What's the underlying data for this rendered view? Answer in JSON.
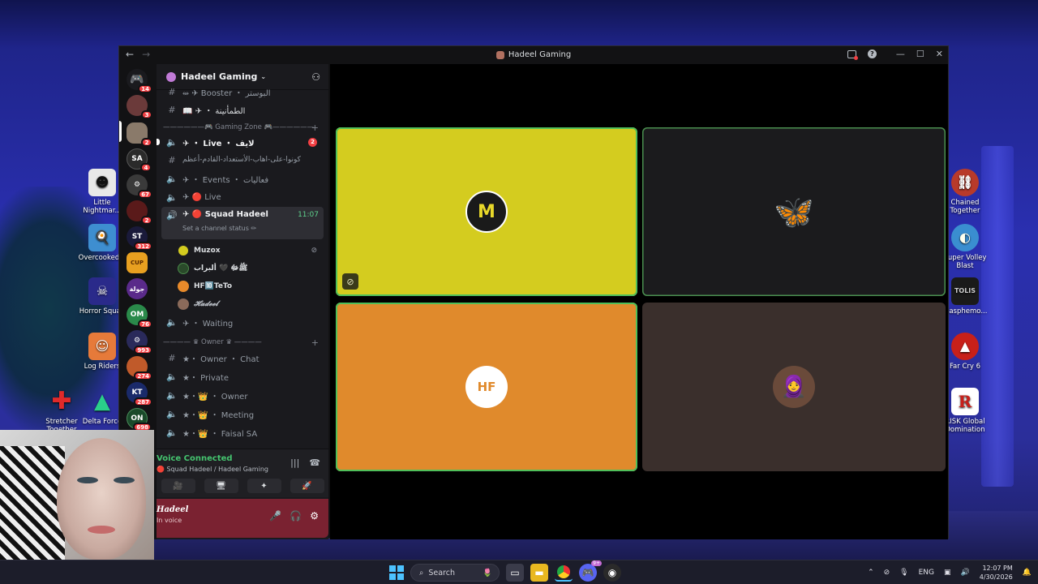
{
  "desktop": {
    "left_icons": [
      {
        "label": "Little Nightmar...",
        "color": "#e8e8e8"
      },
      {
        "label": "Overcooked 2",
        "color": "#3e8ed0"
      },
      {
        "label": "Horror Squad",
        "color": "#2a2a8a"
      },
      {
        "label": "Log Riders",
        "color": "#e67a3a"
      },
      {
        "label": "Stretcher Together",
        "color": "#d02a2a"
      },
      {
        "label": "Delta Force",
        "color": "#2acf8a"
      }
    ],
    "right_icons": [
      {
        "label": "Chained Together",
        "color": "#b83a2a"
      },
      {
        "label": "Super Volley Blast",
        "color": "#3a8ed0"
      },
      {
        "label": "blasphemo...",
        "color": "#1a1a1a"
      },
      {
        "label": "Far Cry 6",
        "color": "#c8201a"
      },
      {
        "label": "RISK Global Domination",
        "color": "#fff"
      }
    ]
  },
  "window": {
    "title": "Hadeel Gaming",
    "back": "←",
    "forward": "→",
    "help": "?",
    "minimize": "—",
    "maximize": "☐",
    "close": "✕"
  },
  "guilds": [
    {
      "glyph": "🎮",
      "badge": "14",
      "bg": "#5865f2"
    },
    {
      "glyph": "",
      "badge": "3",
      "bg": "#6b3a3a"
    },
    {
      "glyph": "",
      "badge": "2",
      "bg": "#8a7a6a"
    },
    {
      "glyph": "SA",
      "badge": "4",
      "bg": "#2a2a2a"
    },
    {
      "glyph": "⚙",
      "badge": "67",
      "bg": "#3a3a3a"
    },
    {
      "glyph": "",
      "badge": "2",
      "bg": "#5a1a1a"
    },
    {
      "glyph": "ST",
      "badge": "312",
      "bg": "#1a1a3a"
    },
    {
      "glyph": "CUP",
      "badge": "",
      "bg": "#e8a020"
    },
    {
      "glyph": "جولة",
      "badge": "",
      "bg": "#5a2a8a"
    },
    {
      "glyph": "OM",
      "badge": "76",
      "bg": "#2a8a4a"
    },
    {
      "glyph": "⚙",
      "badge": "993",
      "bg": "#2a2a5a"
    },
    {
      "glyph": "",
      "badge": "274",
      "bg": "#c05a2a"
    },
    {
      "glyph": "KT",
      "badge": "287",
      "bg": "#1a2a6a"
    },
    {
      "glyph": "ON",
      "badge": "698",
      "bg": "#1a4a2a"
    }
  ],
  "server": {
    "name": "Hadeel Gaming",
    "chevron": "⌄",
    "invite_icon": "person-add-icon"
  },
  "channels": {
    "top": [
      {
        "icon": "#",
        "name": "⥈ ✈ Booster ・ البوستر"
      },
      {
        "icon": "#",
        "name": "📖 ✈ ・ الطمأنينة"
      }
    ],
    "cat_gaming": "——————🎮 Gaming Zone 🎮——————",
    "gaming": [
      {
        "icon": "🔊",
        "name": "✈ ・ Live ・ لايف",
        "badge": "2"
      },
      {
        "icon": "#",
        "name": "كونوا-على-اهاب-الأستعداد-القادم-أعظم"
      },
      {
        "icon": "🔊",
        "name": "✈ ・ Events ・ فعاليات"
      },
      {
        "icon": "🔊",
        "name": "✈ 🔴 Live"
      },
      {
        "icon": "🔊",
        "name": "✈ 🔴 Squad Hadeel",
        "time": "11:07",
        "status": "Set a channel status ✏"
      }
    ],
    "voice_users": [
      {
        "name": "Muzox",
        "color": "#d4cc1f"
      },
      {
        "name": "ﷺﷻ 🖤 ألبراب",
        "color": "#2a4a2a"
      },
      {
        "name": "HF🔟TeTo",
        "color": "#e88a2a"
      },
      {
        "name": "𝓗𝓪𝓭𝓮𝓮𝓵",
        "color": "#8a6a5a"
      }
    ],
    "waiting": {
      "icon": "🔊",
      "name": "✈ ・ Waiting"
    },
    "cat_owner": "———— ♛ Owner ♛ ————",
    "owner": [
      {
        "icon": "#",
        "name": "★・ Owner ・ Chat"
      },
      {
        "icon": "🔊",
        "name": "★・ Private"
      },
      {
        "icon": "🔊",
        "name": "★・👑 ・ Owner"
      },
      {
        "icon": "🔊",
        "name": "★・👑 ・ Meeting"
      },
      {
        "icon": "🔊",
        "name": "★・👑 ・ Faisal SA"
      }
    ]
  },
  "voice": {
    "connected": "Voice Connected",
    "location": "🔴 Squad Hadeel / Hadeel Gaming",
    "buttons": [
      "🎥",
      "🖥",
      "✦",
      "🚀"
    ]
  },
  "user": {
    "name": "Hadeel",
    "status": "In voice"
  },
  "tiles": [
    {
      "bg": "#d4cc1f",
      "avatar_bg": "#1a1a1a",
      "avatar_text": "M",
      "avatar_color": "#e8d82a",
      "speaking": true,
      "muted": true
    },
    {
      "bg": "#1b1b1d",
      "avatar_bg": "#1b1b1d",
      "avatar_text": "🦋",
      "avatar_color": "#8a6ad8",
      "speaking": true,
      "muted": false
    },
    {
      "bg": "#e08a2c",
      "avatar_bg": "#fff",
      "avatar_text": "HF",
      "avatar_color": "#e08a2c",
      "speaking": true,
      "muted": false
    },
    {
      "bg": "#3a2f2c",
      "avatar_bg": "#6a4a3a",
      "avatar_text": "🧕",
      "avatar_color": "#fff",
      "speaking": false,
      "muted": false
    }
  ],
  "taskbar": {
    "search": "Search",
    "lang": "ENG",
    "time": "12:07 PM",
    "date": "4/30/2026",
    "discord_badge": "9+"
  }
}
